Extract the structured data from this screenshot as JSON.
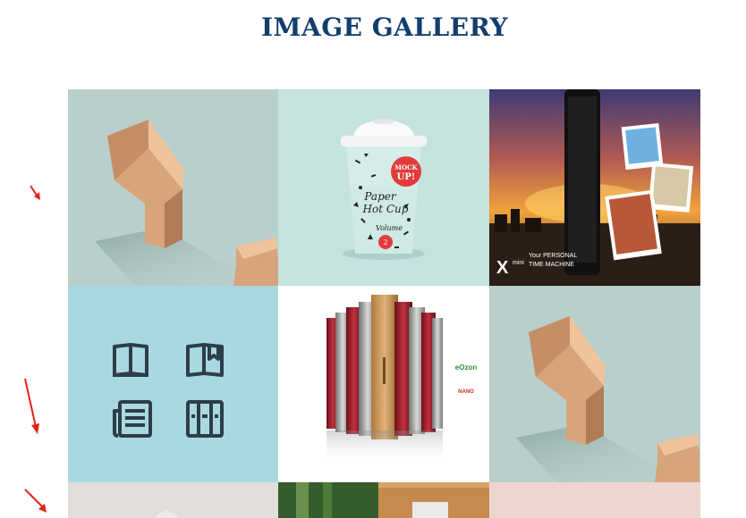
{
  "page": {
    "title": "IMAGE GALLERY"
  },
  "gallery": {
    "items": [
      {
        "alt": "wooden-block-1"
      },
      {
        "alt": "paper-cup-mockup",
        "cup_badge_line1": "MOCK",
        "cup_badge_line2": "UP!",
        "cup_script_line1": "Paper",
        "cup_script_line2": "Hot Cup",
        "cup_volume": "Volume",
        "cup_volume_num": "2"
      },
      {
        "alt": "phone-travel-ad",
        "brand_mark": "X",
        "brand_small": "mini",
        "tagline_line1": "Your PERSONAL",
        "tagline_line2": "TIME MACHINE"
      },
      {
        "alt": "book-icons"
      },
      {
        "alt": "refrigerators-ad",
        "logo_text": "eOzon",
        "logo_small": "NANO"
      },
      {
        "alt": "wooden-block-2"
      },
      {
        "alt": "gallery-item-7"
      },
      {
        "alt": "gallery-item-8"
      },
      {
        "alt": "gallery-item-9"
      }
    ]
  },
  "colors": {
    "title": "#123e6e",
    "annotation_arrow": "#e8211a"
  }
}
